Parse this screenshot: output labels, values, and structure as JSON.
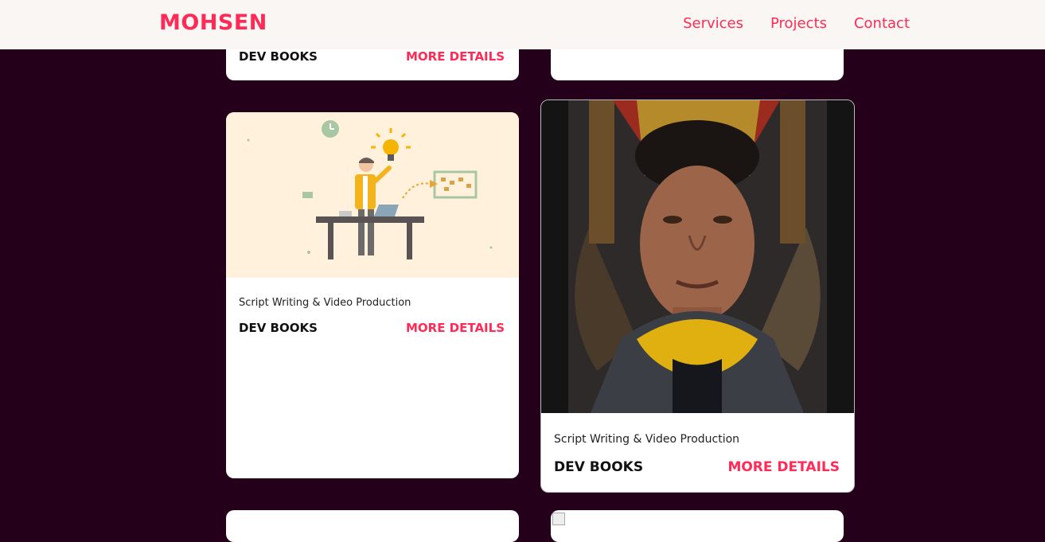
{
  "nav": {
    "logo": "MOHSEN",
    "links": [
      "Services",
      "Projects",
      "Contact"
    ]
  },
  "cards": [
    {
      "brand": "DEV BOOKS",
      "more": "MORE DETAILS"
    },
    {
      "subtitle": "Script Writing & Video Production",
      "brand": "DEV BOOKS",
      "more": "MORE DETAILS"
    },
    {
      "subtitle": "Script Writing & Video Production",
      "brand": "DEV BOOKS",
      "more": "MORE DETAILS"
    }
  ],
  "colors": {
    "accent": "#ff2a55",
    "background": "#25001a",
    "nav_bg": "#faf6f3"
  }
}
